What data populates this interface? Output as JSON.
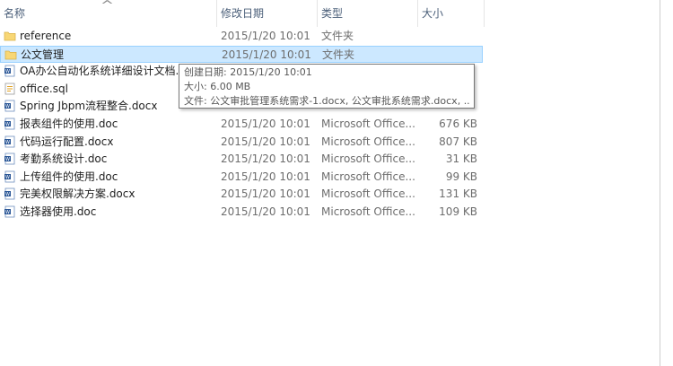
{
  "columns": {
    "name": "名称",
    "date": "修改日期",
    "type": "类型",
    "size": "大小"
  },
  "files": [
    {
      "name": "reference",
      "date": "2015/1/20 10:01",
      "type": "文件夹",
      "size": "",
      "icon": "folder-icon"
    },
    {
      "name": "公文管理",
      "date": "2015/1/20 10:01",
      "type": "文件夹",
      "size": "",
      "icon": "folder-icon",
      "selected": true
    },
    {
      "name": "OA办公自动化系统详细设计文档.doc",
      "date": "",
      "type": "",
      "size": "",
      "icon": "word-doc-icon"
    },
    {
      "name": "office.sql",
      "date": "",
      "type": "",
      "size": "",
      "icon": "sql-file-icon"
    },
    {
      "name": "Spring Jbpm流程整合.docx",
      "date": "",
      "type": "",
      "size": "",
      "icon": "word-doc-icon"
    },
    {
      "name": "报表组件的使用.doc",
      "date": "2015/1/20 10:01",
      "type": "Microsoft Office...",
      "size": "676 KB",
      "icon": "word-doc-icon"
    },
    {
      "name": "代码运行配置.docx",
      "date": "2015/1/20 10:01",
      "type": "Microsoft Office...",
      "size": "807 KB",
      "icon": "word-doc-icon"
    },
    {
      "name": "考勤系统设计.doc",
      "date": "2015/1/20 10:01",
      "type": "Microsoft Office...",
      "size": "31 KB",
      "icon": "word-doc-icon"
    },
    {
      "name": "上传组件的使用.doc",
      "date": "2015/1/20 10:01",
      "type": "Microsoft Office...",
      "size": "99 KB",
      "icon": "word-doc-icon"
    },
    {
      "name": "完美权限解决方案.docx",
      "date": "2015/1/20 10:01",
      "type": "Microsoft Office...",
      "size": "131 KB",
      "icon": "word-doc-icon"
    },
    {
      "name": "选择器使用.doc",
      "date": "2015/1/20 10:01",
      "type": "Microsoft Office...",
      "size": "109 KB",
      "icon": "word-doc-icon"
    }
  ],
  "tooltip": {
    "created": "创建日期: 2015/1/20 10:01",
    "size": "大小: 6.00 MB",
    "files": "文件: 公文审批管理系统需求-1.docx, 公文审批系统需求.docx, ..."
  },
  "colors": {
    "selection": "#cce8ff",
    "selection_border": "#99d1ff",
    "folder": "#f8d775",
    "word": "#2b5797"
  }
}
